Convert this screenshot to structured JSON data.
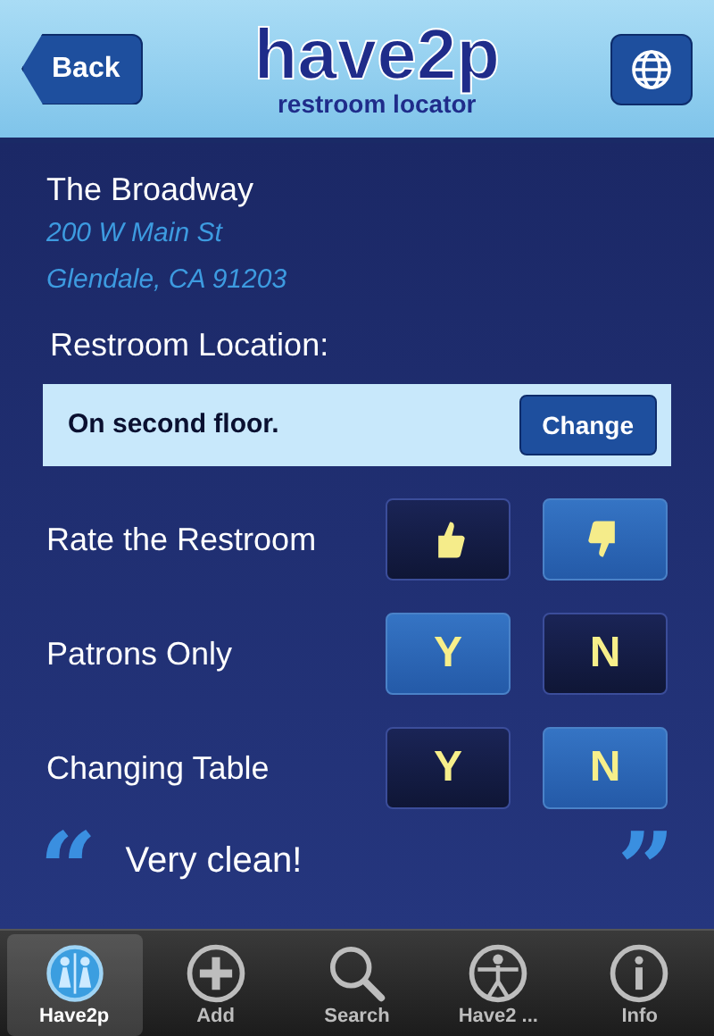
{
  "header": {
    "back": "Back",
    "logo": "have2p",
    "tagline": "restroom locator"
  },
  "place": {
    "name": "The Broadway",
    "address_lines": [
      "200 W Main St",
      "Glendale, CA 91203"
    ]
  },
  "location": {
    "label": "Restroom Location:",
    "value": "On second floor.",
    "button": "Change"
  },
  "ratings": [
    {
      "label": "Rate the Restroom",
      "kind": "thumbs",
      "options": [
        {
          "selected": false
        },
        {
          "selected": true
        }
      ]
    },
    {
      "label": "Patrons Only",
      "kind": "yesno",
      "options": [
        {
          "text": "Y",
          "selected": true
        },
        {
          "text": "N",
          "selected": false
        }
      ]
    },
    {
      "label": "Changing Table",
      "kind": "yesno",
      "options": [
        {
          "text": "Y",
          "selected": false
        },
        {
          "text": "N",
          "selected": true
        }
      ]
    }
  ],
  "comment": {
    "open_quote": "“",
    "text": "Very clean!",
    "close_quote": "”"
  },
  "tabs": [
    {
      "label": "Have2p",
      "kind": "people",
      "selected": true
    },
    {
      "label": "Add",
      "kind": "plus",
      "selected": false
    },
    {
      "label": "Search",
      "kind": "search",
      "selected": false
    },
    {
      "label": "Have2 ...",
      "kind": "figure",
      "selected": false
    },
    {
      "label": "Info",
      "kind": "info",
      "selected": false
    }
  ]
}
